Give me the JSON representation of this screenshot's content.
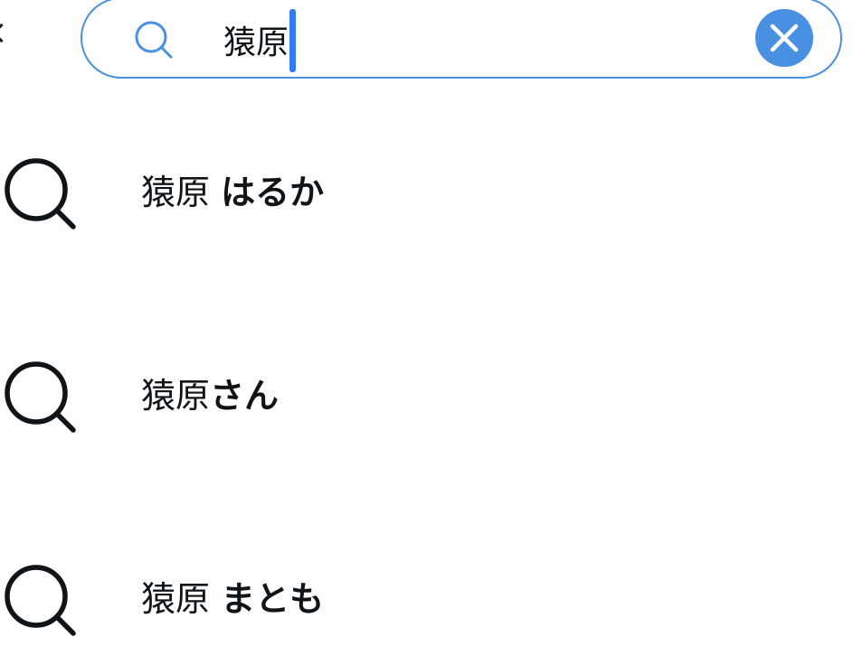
{
  "search": {
    "query": "猿原"
  },
  "suggestions": [
    {
      "prefix": "猿原 ",
      "completion": "はるか"
    },
    {
      "prefix": "猿原",
      "completion": "さん"
    },
    {
      "prefix": "猿原 ",
      "completion": "まとも"
    }
  ],
  "icons": {
    "back": "chevron-left-icon",
    "search": "search-icon",
    "clear": "close-icon"
  },
  "colors": {
    "accent": "#4a90e2",
    "caret": "#2f7cf6",
    "text": "#0f1419",
    "background": "#ffffff"
  }
}
